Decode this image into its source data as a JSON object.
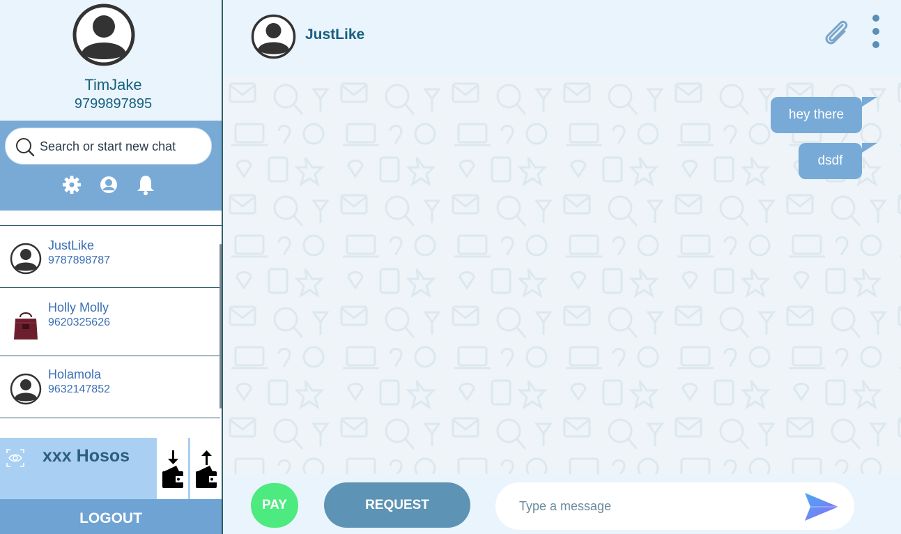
{
  "profile": {
    "name": "TimJake",
    "phone": "9799897895"
  },
  "search": {
    "placeholder": "Search or start new chat"
  },
  "quick_icons": [
    "gear-icon",
    "contact-icon",
    "bell-icon"
  ],
  "contacts": [
    {
      "name": "JustLike",
      "phone": "9787898787",
      "avatar": "default-avatar"
    },
    {
      "name": "Holly Molly",
      "phone": "9620325626",
      "avatar": "handbag-photo"
    },
    {
      "name": "Holamola",
      "phone": "9632147852",
      "avatar": "default-avatar"
    }
  ],
  "wallet": {
    "name": "xxx Hosos"
  },
  "logout_label": "LOGOUT",
  "chat": {
    "contact_name": "JustLike",
    "messages": [
      {
        "text": "hey there",
        "direction": "sent"
      },
      {
        "text": "dsdf",
        "direction": "sent"
      }
    ]
  },
  "composer": {
    "pay_label": "PAY",
    "request_label": "REQUEST",
    "placeholder": "Type a message"
  },
  "colors": {
    "accent": "#79aad6",
    "bubble": "#78aad7",
    "pay": "#4cea7f",
    "request": "#5d93b4",
    "text_primary": "#17607f"
  }
}
